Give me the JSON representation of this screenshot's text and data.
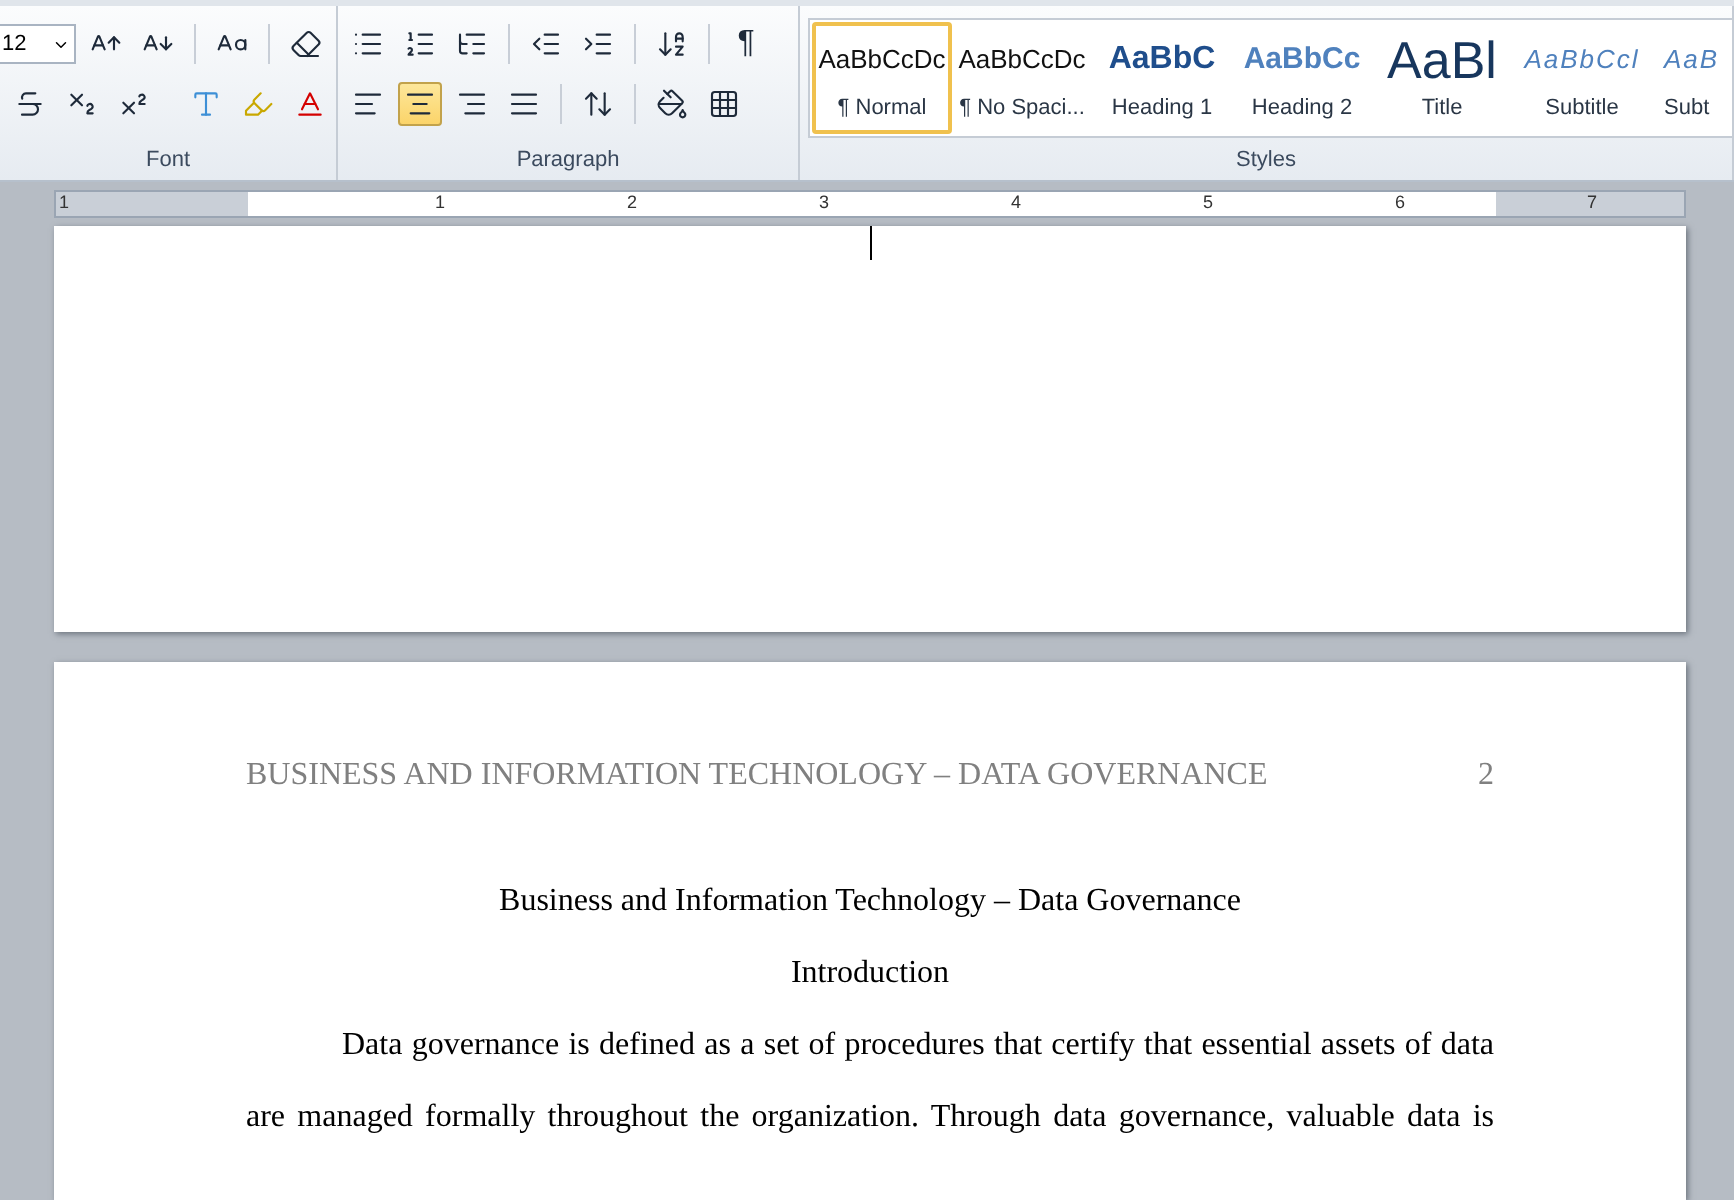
{
  "ribbon": {
    "font_group": {
      "label": "Font",
      "size": "12"
    },
    "paragraph_group": {
      "label": "Paragraph",
      "alignment": [
        {
          "kind": "left",
          "selected": false
        },
        {
          "kind": "center",
          "selected": true
        },
        {
          "kind": "right",
          "selected": false
        },
        {
          "kind": "justify",
          "selected": false
        }
      ],
      "show_marks": "¶"
    },
    "styles_group": {
      "label": "Styles",
      "styles": [
        {
          "kind": "normal",
          "preview": "AaBbCcDc",
          "label": "¶ Normal",
          "selected": true
        },
        {
          "kind": "normal",
          "preview": "AaBbCcDc",
          "label": "¶ No Spaci...",
          "selected": false
        },
        {
          "kind": "heading1",
          "preview": "AaBbC",
          "label": "Heading 1",
          "selected": false
        },
        {
          "kind": "heading2",
          "preview": "AaBbCc",
          "label": "Heading 2",
          "selected": false
        },
        {
          "kind": "title",
          "preview": "AaBl",
          "label": "Title",
          "selected": false
        },
        {
          "kind": "subtitle",
          "preview": "AaBbCcl",
          "label": "Subtitle",
          "selected": false
        },
        {
          "kind": "subtitle",
          "preview": "AaB",
          "label": "Subt",
          "selected": false
        }
      ]
    }
  },
  "ruler": {
    "numbers": [
      "1",
      "1",
      "2",
      "3",
      "4",
      "5",
      "6",
      "7"
    ]
  },
  "page_2": {
    "header": "BUSINESS AND INFORMATION TECHNOLOGY – DATA GOVERNANCE",
    "page_number": "2",
    "title": "Business and Information Technology – Data Governance",
    "heading": "Introduction",
    "lines": [
      "Data governance is defined as a set of procedures that certify that essential assets of data",
      "are managed formally throughout the organization. Through data governance, valuable data is"
    ]
  }
}
